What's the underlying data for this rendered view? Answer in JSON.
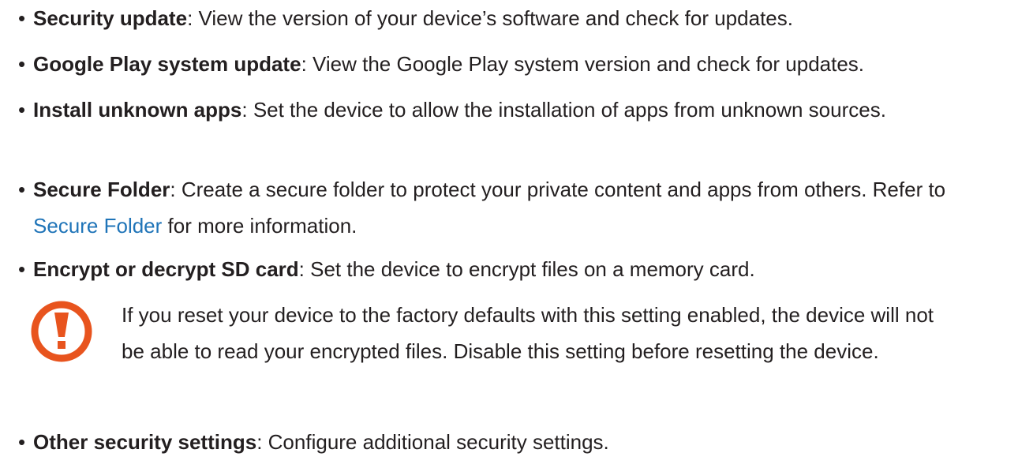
{
  "items": [
    {
      "bullet": "•",
      "term": "Security update",
      "sep": ": ",
      "desc": "View the version of your device’s software and check for updates."
    },
    {
      "bullet": "•",
      "term": "Google Play system update",
      "sep": ": ",
      "desc": "View the Google Play system version and check for updates."
    },
    {
      "bullet": "•",
      "term": "Install unknown apps",
      "sep": ": ",
      "desc": "Set the device to allow the installation of apps from unknown sources."
    },
    {
      "bullet": "•",
      "term": "Secure Folder",
      "sep": ": ",
      "desc": "Create a secure folder to protect your private content and apps from others. Refer to ",
      "link": "Secure Folder",
      "desc_after": " for more information."
    },
    {
      "bullet": "•",
      "term": "Encrypt or decrypt SD card",
      "sep": ": ",
      "desc": "Set the device to encrypt files on a memory card."
    },
    {
      "bullet": "•",
      "term": "Other security settings",
      "sep": ": ",
      "desc": "Configure additional security settings."
    }
  ],
  "note": {
    "icon": "caution-icon",
    "icon_color": "#e8541e",
    "text": "If you reset your device to the factory defaults with this setting enabled, the device will not be able to read your encrypted files. Disable this setting before resetting the device."
  },
  "colors": {
    "text": "#231f20",
    "link": "#1f74b8"
  }
}
